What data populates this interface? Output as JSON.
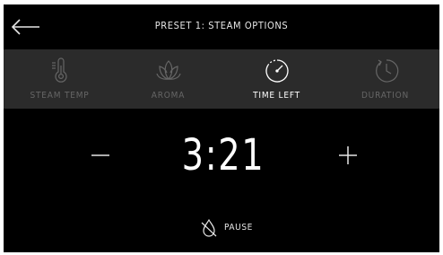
{
  "header": {
    "title": "PRESET 1: STEAM OPTIONS",
    "back_icon": "arrow-left-icon"
  },
  "tabs": [
    {
      "label": "STEAM TEMP",
      "icon": "thermometer-icon",
      "active": false
    },
    {
      "label": "AROMA",
      "icon": "lotus-icon",
      "active": false
    },
    {
      "label": "TIME LEFT",
      "icon": "timer-icon",
      "active": true
    },
    {
      "label": "DURATION",
      "icon": "clock-icon",
      "active": false
    }
  ],
  "timer": {
    "value": "3:21",
    "decrease_label": "−",
    "increase_label": "+"
  },
  "pause": {
    "label": "PAUSE",
    "icon": "drop-off-icon"
  },
  "colors": {
    "background": "#000000",
    "tab_bar": "#2b2b2b",
    "active_text": "#ffffff",
    "inactive_text": "#666666"
  }
}
